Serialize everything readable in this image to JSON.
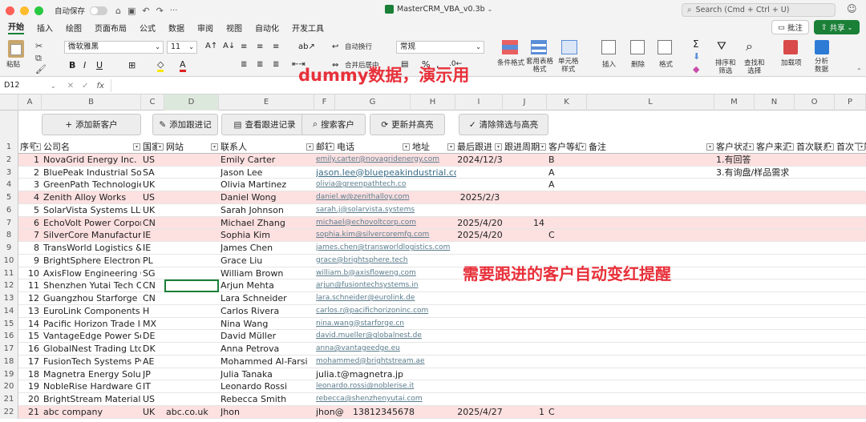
{
  "window": {
    "title": "MasterCRM_VBA_v0.3b",
    "autosave_label": "自动保存",
    "search_placeholder": "Search (Cmd + Ctrl + U)"
  },
  "tabs": [
    "开始",
    "插入",
    "绘图",
    "页面布局",
    "公式",
    "数据",
    "审阅",
    "视图",
    "自动化",
    "开发工具"
  ],
  "ribbon": {
    "paste": "粘贴",
    "font_name": "微软雅黑",
    "font_size": "11",
    "wrap": "自动换行",
    "merge": "合并后居中",
    "number_format": "常规",
    "cond_format": "条件格式",
    "table_format": "套用表格\n格式",
    "cell_style": "单元格\n样式",
    "insert": "插入",
    "delete": "删除",
    "format": "格式",
    "sort_filter": "排序和\n筛选",
    "find_select": "查找和\n选择",
    "addins": "加载项",
    "analyze": "分析\n数据",
    "comment_btn": "批注",
    "share_btn": "共享"
  },
  "formula": {
    "name_box": "D12",
    "fx": "fx",
    "content": ""
  },
  "columns": [
    "A",
    "B",
    "C",
    "D",
    "E",
    "F",
    "G",
    "H",
    "I",
    "J",
    "K",
    "L",
    "M",
    "N",
    "O",
    "P"
  ],
  "buttons": {
    "add_customer": "添加新客户",
    "add_followup": "添加跟进记",
    "view_followup": "查看跟进记录",
    "search": "搜索客户",
    "refresh": "更新并高亮",
    "clear": "清除筛选与高亮"
  },
  "headers": [
    "序号",
    "公司名",
    "国家",
    "网站",
    "联系人",
    "邮箱",
    "电话",
    "地址",
    "最后跟进",
    "跟进周期",
    "客户等级",
    "备注",
    "客户状态",
    "客户来源",
    "首次联系",
    "首次下单"
  ],
  "rows": [
    {
      "n": "1",
      "company": "NovaGrid Energy Inc.",
      "country": "US",
      "contact": "Emily Carter",
      "email": "emily.carter@novagridenergy.com",
      "last": "2024/12/3",
      "level": "B",
      "status": "1.有回答",
      "hl": true
    },
    {
      "n": "2",
      "company": "BluePeak Industrial Soluti",
      "country": "SA",
      "contact": "Jason Lee",
      "email": "jason.lee@bluepeakindustrial.com",
      "level": "A",
      "status": "3.有询盘/样品需求",
      "bigmail": true
    },
    {
      "n": "3",
      "company": "GreenPath Technologies (",
      "country": "UK",
      "contact": "Olivia Martinez",
      "email": "olivia@greenpathtech.co",
      "level": "A"
    },
    {
      "n": "4",
      "company": "Zenith Alloy Works",
      "country": "US",
      "contact": "Daniel Wong",
      "email": "daniel.w@zenithalloy.com",
      "last": "2025/2/3",
      "hl": true
    },
    {
      "n": "5",
      "company": "SolarVista Systems LLC",
      "country": "UK",
      "contact": "Sarah Johnson",
      "email": "sarah.j@solarvista.systems"
    },
    {
      "n": "6",
      "company": "EchoVolt Power Corporati",
      "country": "CN",
      "contact": "Michael Zhang",
      "email": "michael@echovoltcorp.com",
      "last": "2025/4/20",
      "cycle": "14",
      "hl": true
    },
    {
      "n": "7",
      "company": "SilverCore Manufacturing",
      "country": "IE",
      "contact": "Sophia Kim",
      "email": "sophia.kim@silvercoremfg.com",
      "last": "2025/4/20",
      "level": "C",
      "hl": true
    },
    {
      "n": "8",
      "company": "TransWorld Logistics & Su",
      "country": "IE",
      "contact": "James Chen",
      "email": "james.chen@transworldlogistics.com"
    },
    {
      "n": "9",
      "company": "BrightSphere Electronics I",
      "country": "PL",
      "contact": "Grace Liu",
      "email": "grace@brightsphere.tech"
    },
    {
      "n": "10",
      "company": "AxisFlow Engineering Co.",
      "country": "SG",
      "contact": "William Brown",
      "email": "william.b@axisfloweng.com"
    },
    {
      "n": "11",
      "company": "Shenzhen Yutai Tech Co.,",
      "country": "CN",
      "contact": "Arjun Mehta",
      "email": "arjun@fusiontechsystems.in"
    },
    {
      "n": "12",
      "company": "Guangzhou Starforge Ind",
      "country": "CN",
      "contact": "Lara Schneider",
      "email": "lara.schneider@eurolink.de"
    },
    {
      "n": "13",
      "company": "EuroLink Components Gmb",
      "country": "H",
      "contact": "Carlos Rivera",
      "email": "carlos.r@pacifichorizoninc.com"
    },
    {
      "n": "14",
      "company": "Pacific Horizon Trade Inc.",
      "country": "MX",
      "contact": "Nina Wang",
      "email": "nina.wang@starforge.cn"
    },
    {
      "n": "15",
      "company": "VantageEdge Power Solut",
      "country": "DE",
      "contact": "David Müller",
      "email": "david.mueller@globalnest.de"
    },
    {
      "n": "16",
      "company": "GlobalNest Trading Ltd.",
      "country": "DK",
      "contact": "Anna Petrova",
      "email": "anna@vantageedge.eu"
    },
    {
      "n": "17",
      "company": "FusionTech Systems Pvt. L",
      "country": "AE",
      "contact": "Mohammed Al-Farsi",
      "email": "mohammed@brightstream.ae"
    },
    {
      "n": "18",
      "company": "Magnetra Energy Solution",
      "country": "JP",
      "contact": "Julia Tanaka",
      "email": "julia.t@magnetra.jp",
      "bigmail": true
    },
    {
      "n": "19",
      "company": "NobleRise Hardware Grou",
      "country": "IT",
      "contact": "Leonardo Rossi",
      "email": "leonardo.rossi@noblerise.it"
    },
    {
      "n": "20",
      "company": "BrightStream Materials Co",
      "country": "US",
      "contact": "Rebecca Smith",
      "email": "rebecca@shenzhenyutai.com"
    },
    {
      "n": "21",
      "company": "abc company",
      "country": "UK",
      "site": "abc.co.uk",
      "contact": "Jhon",
      "email": "jhon@",
      "phone": "13812345678",
      "last": "2025/4/27",
      "cycle": "1",
      "level": "C",
      "hl": true,
      "bigmail": true
    }
  ],
  "overlay": {
    "dummy": "dummy数据，演示用",
    "annotation": "需要跟进的客户自动变红提醒"
  },
  "colors": {
    "accent": "#1a7f37",
    "highlight_row": "#fde0e0",
    "annotation": "#e8303a"
  }
}
